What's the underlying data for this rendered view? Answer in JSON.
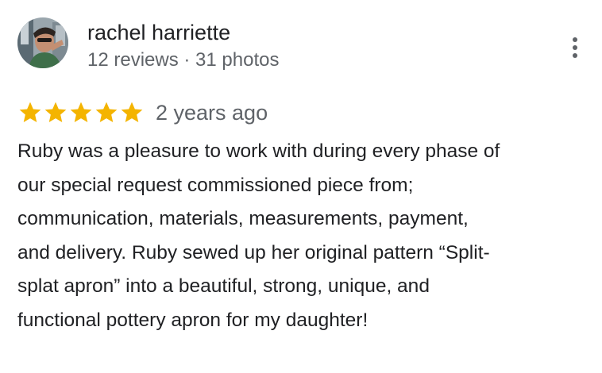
{
  "reviewer": {
    "name": "rachel harriette",
    "meta": "12 reviews · 31 photos",
    "avatar_icon": "reviewer-avatar-photo"
  },
  "review": {
    "rating": 5,
    "rating_max": 5,
    "date": "2 years ago",
    "text_lines": [
      "Ruby was a pleasure to work with during every phase of",
      "our special request commissioned piece from;",
      "communication, materials, measurements, payment,",
      "and delivery. Ruby sewed up her original pattern “Split-",
      "splat apron”  into a beautiful, strong, unique, and",
      "functional pottery apron for my daughter!"
    ]
  },
  "actions": {
    "more_icon": "more-vert-icon"
  },
  "colors": {
    "star": "#f4b400",
    "primary_text": "#202124",
    "secondary_text": "#5f6368"
  }
}
